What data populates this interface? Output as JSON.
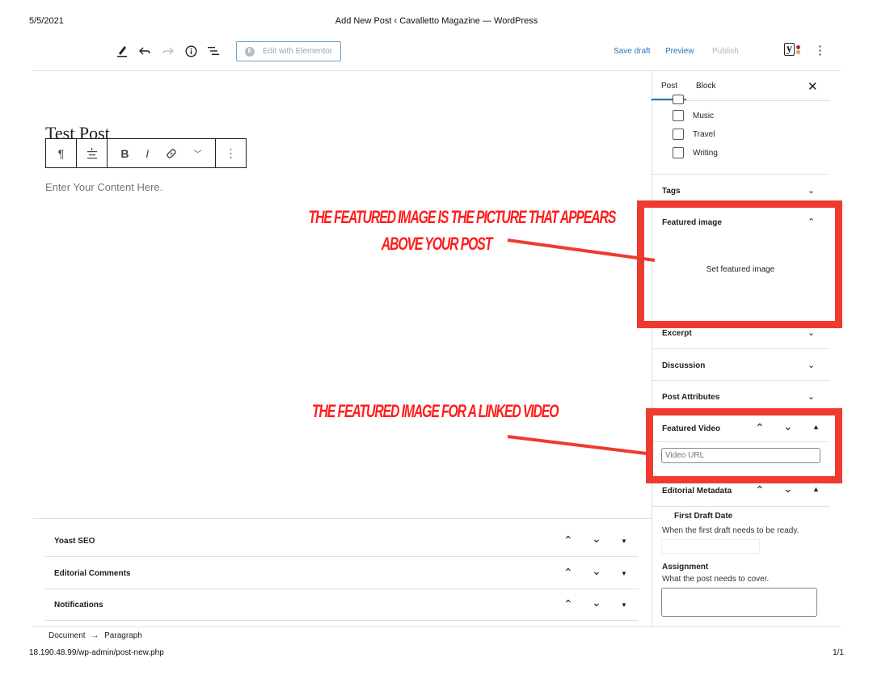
{
  "print": {
    "date": "5/5/2021",
    "title": "Add New Post ‹ Cavalletto Magazine — WordPress",
    "url": "18.190.48.99/wp-admin/post-new.php",
    "page": "1/1"
  },
  "toolbar": {
    "edit_with_elementor": "Edit with Elementor",
    "save_draft": "Save draft",
    "preview": "Preview",
    "publish": "Publish"
  },
  "editor": {
    "post_title": "Test Post",
    "content_placeholder": "Enter Your Content Here."
  },
  "annotations": {
    "featured_image_line1": "THE FEATURED IMAGE IS THE PICTURE THAT APPEARS",
    "featured_image_line2": "ABOVE YOUR POST",
    "featured_video": "THE FEATURED IMAGE FOR A LINKED VIDEO",
    "color": "#f03a30"
  },
  "sidebar": {
    "tabs": [
      "Post",
      "Block"
    ],
    "categories": [
      "Music",
      "Travel",
      "Writing"
    ],
    "panels": {
      "tags": "Tags",
      "featured_image": "Featured image",
      "set_featured_image": "Set featured image",
      "excerpt": "Excerpt",
      "discussion": "Discussion",
      "post_attributes": "Post Attributes",
      "featured_video": "Featured Video",
      "video_url_placeholder": "Video URL",
      "editorial_metadata": "Editorial Metadata"
    },
    "editorial": {
      "first_draft_label": "First Draft Date",
      "first_draft_desc": "When the first draft needs to be ready.",
      "assignment_label": "Assignment",
      "assignment_desc": "What the post needs to cover."
    }
  },
  "metaboxes": [
    "Yoast SEO",
    "Editorial Comments",
    "Notifications"
  ],
  "breadcrumb": {
    "document": "Document",
    "arrow": "→",
    "paragraph": "Paragraph"
  },
  "colors": {
    "accent_blue": "#2a73b7",
    "annotation_red": "#f03a30",
    "yoast_dots": [
      "#a4286a",
      "#e2a23b",
      "#d93f21"
    ]
  }
}
